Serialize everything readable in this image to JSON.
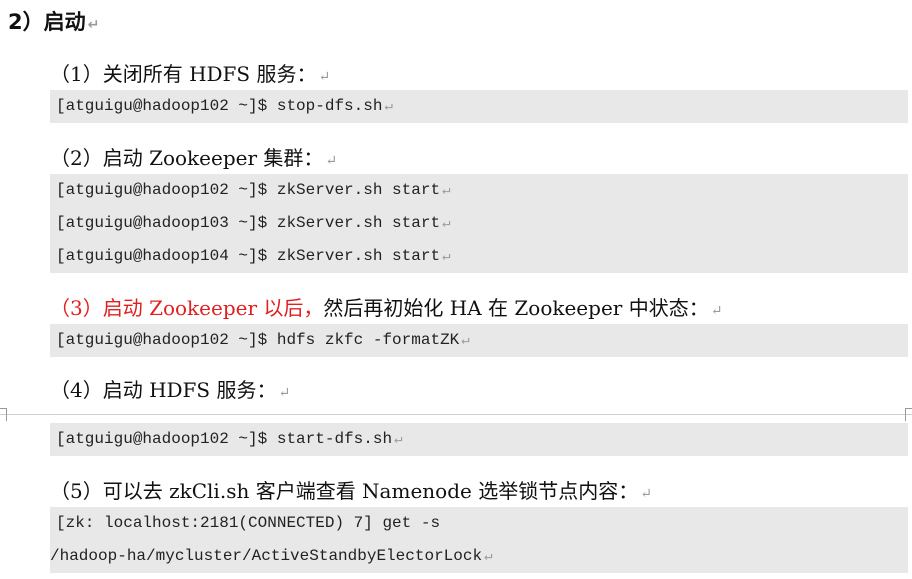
{
  "heading": "2）启动",
  "steps": [
    {
      "label": "（1）关闭所有 HDFS 服务："
    },
    {
      "label": "（2）启动 Zookeeper 集群："
    },
    {
      "label_red": "（3）启动 Zookeeper 以后，",
      "label_rest": "然后再初始化 HA 在 Zookeeper 中状态："
    },
    {
      "label": "（4）启动 HDFS 服务："
    },
    {
      "label": "（5）可以去 zkCli.sh 客户端查看 Namenode 选举锁节点内容："
    }
  ],
  "commands": {
    "stop": [
      "[atguigu@hadoop102 ~]$ stop-dfs.sh"
    ],
    "zk": [
      "[atguigu@hadoop102 ~]$ zkServer.sh start",
      "[atguigu@hadoop103 ~]$ zkServer.sh start",
      "[atguigu@hadoop104 ~]$ zkServer.sh start"
    ],
    "format": [
      "[atguigu@hadoop102 ~]$ hdfs zkfc -formatZK"
    ],
    "start": [
      "[atguigu@hadoop102 ~]$ start-dfs.sh"
    ],
    "zkcli": [
      "[zk: localhost:2181(CONNECTED) 7] get -s",
      "/hadoop-ha/mycluster/ActiveStandbyElectorLock"
    ]
  },
  "para_mark": "↵",
  "colors": {
    "highlight": "#e02020",
    "code_bg": "#e8e8e8"
  }
}
